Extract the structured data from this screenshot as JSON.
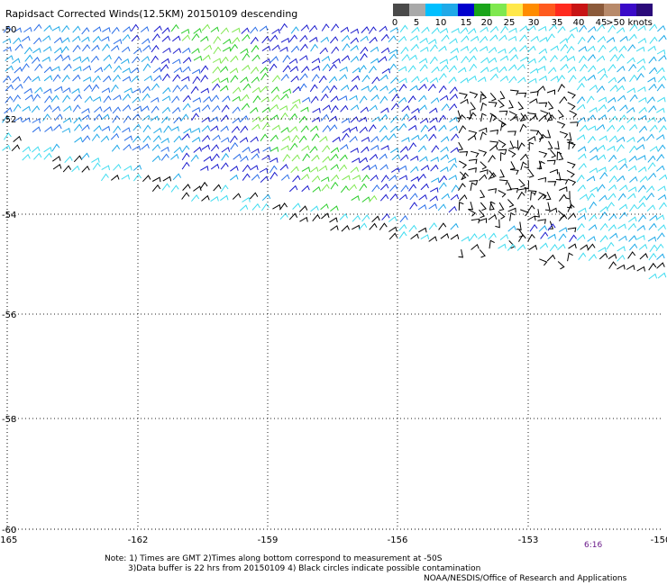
{
  "title": "Rapidsact Corrected Winds(12.5KM) 20150109 descending",
  "scale": {
    "colors": [
      "#4a4a4a",
      "#a9a9a9",
      "#00bfff",
      "#1fa9e8",
      "#0000cd",
      "#1aa51a",
      "#7fe84f",
      "#ffe84a",
      "#ff8c00",
      "#ff5a1e",
      "#ff2a1e",
      "#c81414",
      "#8b5a3a",
      "#b88a6a",
      "#3a0ac8",
      "#2a0a7a"
    ],
    "labels": [
      "0",
      "5",
      "10",
      "15",
      "20",
      "25",
      "30",
      "35",
      "40",
      "45",
      ">50 knots"
    ]
  },
  "axes": {
    "x_ticks": [
      "-165",
      "-162",
      "-159",
      "-156",
      "-153",
      "-150"
    ],
    "y_ticks": [
      "-50",
      "-52",
      "-54",
      "-56",
      "-58",
      "-60"
    ]
  },
  "timestamp": "6:16",
  "notes": {
    "line1": "Note: 1) Times are GMT 2)Times along bottom correspond to measurement at -50S",
    "line2": "3)Data buffer is 22 hrs from 20150109 4) Black circles indicate possible contamination"
  },
  "credit": "NOAA/NESDIS/Office of Research and Applications",
  "colors": {
    "barb_black": "#000000",
    "barb_navy": "#1a1acd",
    "barb_blue": "#2a6ee8",
    "barb_skyblue": "#1fa9e8",
    "barb_cyan": "#3fdcf0",
    "barb_green": "#2acd2a",
    "barb_lightgreen": "#7fe84f",
    "timestamp": "#6a1a8a"
  }
}
